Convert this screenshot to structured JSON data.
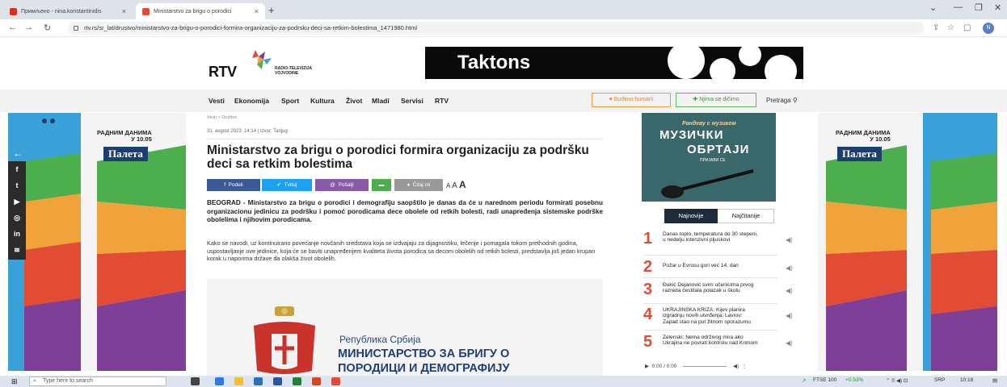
{
  "browser": {
    "tabs": [
      {
        "label": "Примљено - nina.konstantinidis",
        "active": false
      },
      {
        "label": "Ministarstvo za brigu o porodici",
        "active": true
      }
    ],
    "url": "rtv.rs/sr_lat/drustvo/ministarstvo-za-brigu-o-porodici-formira-organizaciju-za-podrsku-deci-sa-retkim-bolestima_1471980.html",
    "profile_initial": "N"
  },
  "header": {
    "logo_text": "RTV",
    "logo_sub1": "RADIO-TELEVIZIJA",
    "logo_sub2": "VOJVODINE",
    "ad_text": "Taktons"
  },
  "nav": {
    "items": [
      "Vesti",
      "Ekonomija",
      "Sport",
      "Kultura",
      "Život",
      "Mladi",
      "Servisi",
      "RTV"
    ],
    "budimo": "Budimo humani",
    "njima": "Njima se dičimo",
    "search": "Pretraga"
  },
  "side_ad": {
    "line1": "РАДНИМ ДАНИМА",
    "line2": "У 10.05",
    "badge": "Палета"
  },
  "article": {
    "breadcrumb": "Vesti > Društvo",
    "meta": "31. avgust 2023. 14:14 | Izvor: Tanjug",
    "title": "Ministarstvo za brigu o porodici formira organizaciju za podršku deci sa retkim bolestima",
    "share": {
      "facebook": "Podeli",
      "twitter": "Tvituj",
      "email": "Pošalji",
      "listen": "Čitaj mi",
      "font_small": "A",
      "font_mid": "A",
      "font_large": "A"
    },
    "lead": "BEOGRAD - Ministarstvo za brigu o porodici i demografiju saopštilo je danas da će u narednom periodu formirati posebnu organizacionu jedinicu za podršku i pomoć porodicama dece obolele od retkih bolesti, radi unapređenja sistemske podrške obolelima i njihovim porodicama.",
    "body": "Kako se navodi, uz kontinuirano povećanje novčanih sredstava koja se izdvajaju za dijagnostiku, lečenje i pomagala tokom prethodnih godina, uspostavljanje ove jedinice, koja će se baviti unapređenjem kvaliteta života porodica sa decom obolelih od retkih bolesti, predstavlja još jedan krupan korak u naporima države da olakša život obolelih.",
    "image_line1": "Република Србија",
    "image_line2": "МИНИСТАРСТВО ЗА БРИГУ О",
    "image_line3": "ПОРОДИЦИ И ДЕМОГРАФИЈУ"
  },
  "promo": {
    "top": "Рандеву с музиком",
    "title1": "МУЗИЧКИ",
    "title2": "ОБРТАЈИ",
    "sub": "ПРИЈАВИ СЕ"
  },
  "popular": {
    "tab_latest": "Najnovije",
    "tab_read": "Najčitanije",
    "items": [
      {
        "num": "1",
        "text": "Danas toplo, temperatura do 30 stepeni, u nedelju intenzivni pljuskovi"
      },
      {
        "num": "2",
        "text": "Požar u Evrosu gori već 14. dan"
      },
      {
        "num": "3",
        "text": "Đukić Dejanović svim učenicima prvog razreda čestitala polazak u školu"
      },
      {
        "num": "4",
        "text": "UKRAJINSKA KRIZA: Kijev planira izgradnju novih utvrđenja; Lavrov: Zapad stao na put žitnom sporazumu"
      },
      {
        "num": "5",
        "text": "Zelenski: Nema održivog mira ako Ukrajina ne povrati kontrolu nad Krimom"
      }
    ],
    "audio_time": "0:00 / 0:00"
  },
  "taskbar": {
    "search_placeholder": "Type here to search",
    "ticker": "FTSE 100",
    "ticker_change": "+0.53%",
    "lang": "SRP",
    "time": "10:18"
  },
  "colors": {
    "accent_red": "#e24b34",
    "nav_dark": "#1d2b3a",
    "facebook": "#3b5998",
    "twitter": "#1da1f2",
    "email": "#8a5aa8",
    "green": "#4cae4c"
  }
}
